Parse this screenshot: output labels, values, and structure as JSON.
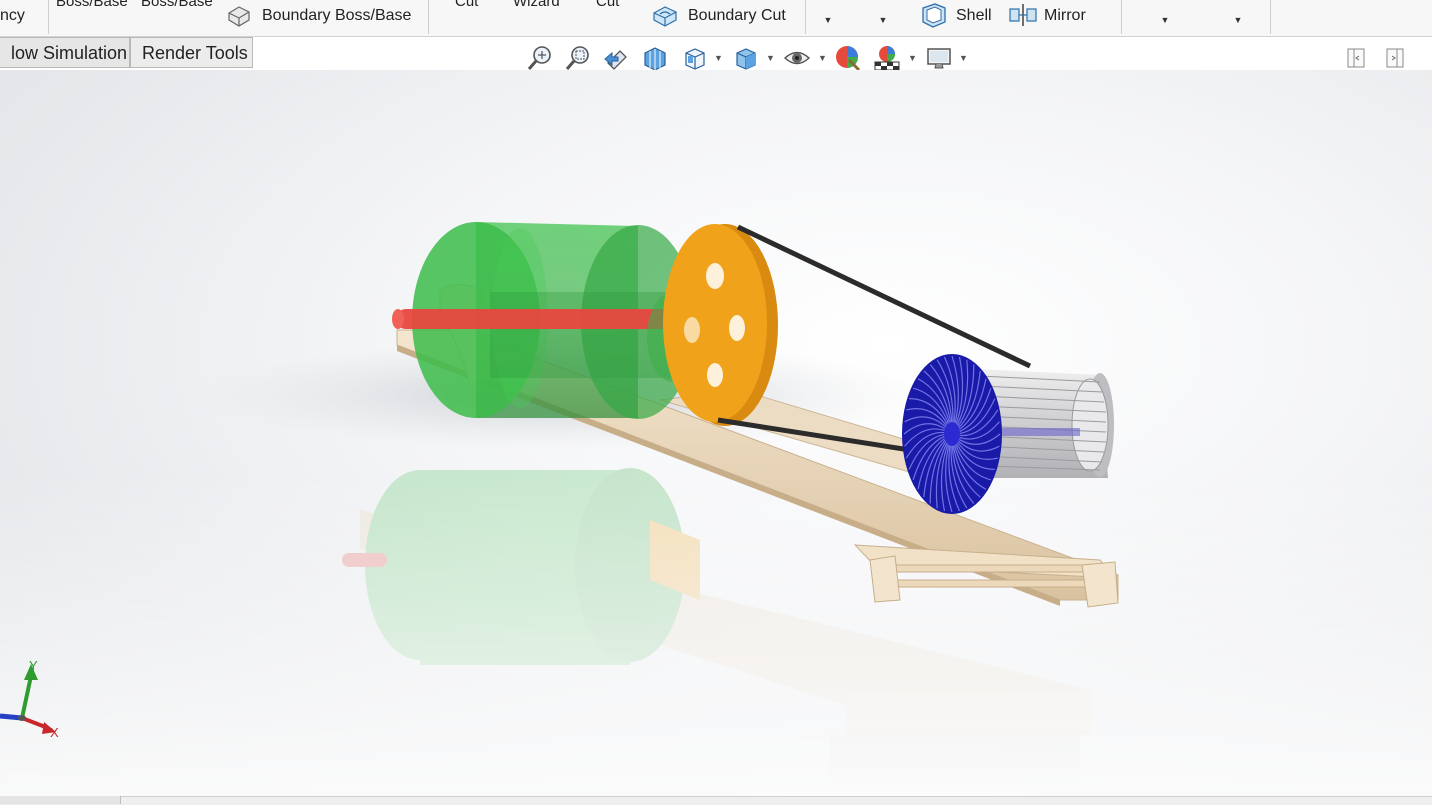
{
  "ribbon": {
    "left_partial": "ncy",
    "boss_base_1": "Boss/Base",
    "boss_base_2": "Boss/Base",
    "boundary_boss": "Boundary Boss/Base",
    "cut_1": "Cut",
    "wizard": "Wizard",
    "cut_2": "Cut",
    "boundary_cut": "Boundary Cut",
    "shell": "Shell",
    "mirror": "Mirror"
  },
  "tabs": {
    "flow_simulation": "low Simulation",
    "render_tools": "Render Tools"
  },
  "hud": {
    "icons": [
      "zoom-to-fit-icon",
      "zoom-to-area-icon",
      "previous-view-icon",
      "section-view-icon",
      "view-orientation-icon",
      "display-style-icon",
      "hide-show-items-icon",
      "edit-appearance-icon",
      "apply-scene-icon",
      "view-settings-icon"
    ]
  },
  "triad": {
    "y": "Y",
    "x": "X"
  },
  "colors": {
    "motor_green": "#3dbb4a",
    "pulley_orange": "#f0a21a",
    "shaft_red": "#e8473f",
    "fan_blue": "#1a1aa8",
    "base_beige": "#efdcc0",
    "belt": "#2b2b2b"
  }
}
